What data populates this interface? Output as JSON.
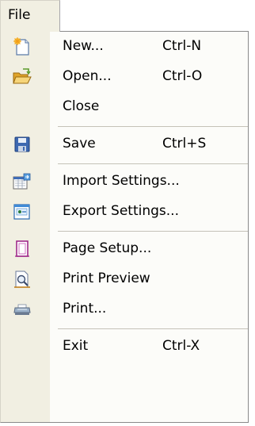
{
  "menu": {
    "title": "File"
  },
  "items": {
    "new": {
      "label": "New...",
      "shortcut": "Ctrl-N",
      "icon": "new-document-icon"
    },
    "open": {
      "label": "Open...",
      "shortcut": "Ctrl-O",
      "icon": "open-folder-icon"
    },
    "close": {
      "label": "Close"
    },
    "save": {
      "label": "Save",
      "shortcut": "Ctrl+S",
      "icon": "floppy-disk-icon"
    },
    "import": {
      "label": "Import Settings...",
      "icon": "import-settings-icon"
    },
    "export": {
      "label": "Export Settings...",
      "icon": "export-settings-icon"
    },
    "page_setup": {
      "label": "Page Setup...",
      "icon": "page-setup-icon"
    },
    "print_preview": {
      "label": "Print Preview",
      "icon": "print-preview-icon"
    },
    "print": {
      "label": "Print...",
      "icon": "printer-icon"
    },
    "exit": {
      "label": "Exit",
      "shortcut": "Ctrl-X"
    }
  }
}
